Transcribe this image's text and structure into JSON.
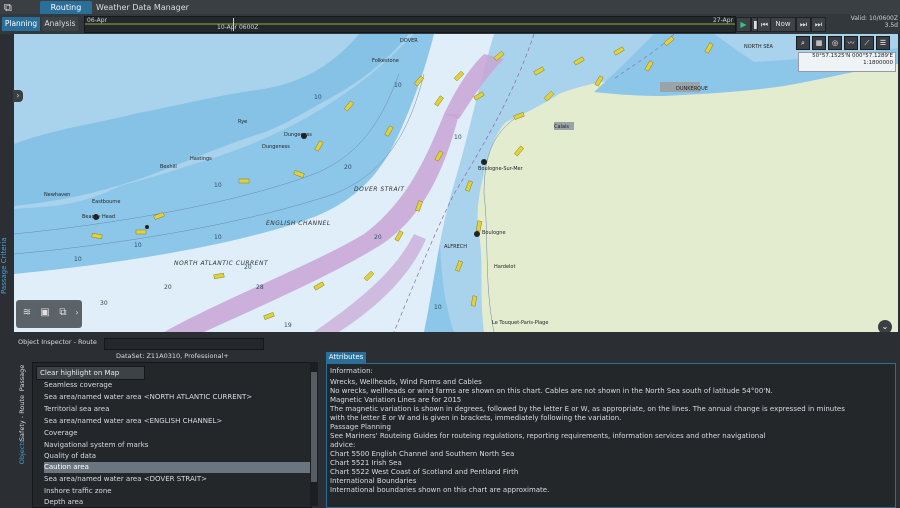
{
  "header": {
    "tabs": [
      {
        "label": "Routing",
        "active": true
      },
      {
        "label": "Weather Data Manager",
        "active": false
      }
    ]
  },
  "toolbar": {
    "mode_tabs": [
      {
        "label": "Planning",
        "active": true
      },
      {
        "label": "Analysis",
        "active": false
      }
    ],
    "timeline": {
      "start_label": "06-Apr",
      "end_label": "27-Apr",
      "cursor_label": "10-Apr",
      "cursor_time": "0600Z"
    },
    "now_label": "Now",
    "valid_label": "Valid: 10/0600Z",
    "valid_sub": "3.5d"
  },
  "map": {
    "coord_lat_lon": "50°57.1525'N 000°57.1289'E",
    "scale": "1:1800000",
    "places": [
      "DOVER",
      "Folkestone",
      "NORTH SEA",
      "DUNKERQUE",
      "Calais",
      "Rye",
      "Dungeness",
      "Dungeness",
      "Hastings",
      "Bexhill",
      "Newhaven",
      "Eastbourne",
      "Beachy Head",
      "Boulogne",
      "Hardelot",
      "Le Touquet-Paris-Plage",
      "Boulogne-Sur-Mer",
      "ALFRECH",
      "DOVER STRAIT"
    ],
    "sea_labels": {
      "english_channel": "ENGLISH CHANNEL",
      "north_atlantic": "NORTH ATLANTIC CURRENT",
      "dover_strait": "DOVER STRAIT"
    },
    "depths": [
      "10",
      "10",
      "20",
      "20",
      "20",
      "28",
      "30",
      "10",
      "10",
      "10",
      "20",
      "10",
      "19",
      "10",
      "10"
    ]
  },
  "left_strip": {
    "label": "Passage Criteria"
  },
  "object_inspector": {
    "title": "Object Inspector - Route",
    "dataset_label": "DataSet: Z11A0310, Professional+",
    "vertical_tabs": [
      {
        "label": "Objects",
        "active": true
      },
      {
        "label": "Safety - Route",
        "active": false
      },
      {
        "label": "Passage",
        "active": false
      }
    ],
    "clear_button": "Clear highlight on Map",
    "items": [
      "Seamless coverage",
      "Sea area/named water area  <NORTH ATLANTIC CURRENT>",
      "Territorial sea area",
      "Sea area/named water area  <ENGLISH CHANNEL>",
      "Coverage",
      "Navigational system of marks",
      "Quality of data",
      "Caution area",
      "Sea area/named water area  <DOVER STRAIT>",
      "Inshore traffic zone",
      "Depth area"
    ],
    "highlighted_index": 7
  },
  "attributes": {
    "tab_label": "Attributes",
    "lines": [
      "Information:",
      "Wrecks, Wellheads, Wind Farms and Cables",
      "No wrecks, wellheads or wind farms are shown on this chart. Cables are not shown in the North Sea south of latitude 54°00'N.",
      "Magnetic Variation Lines are for 2015",
      "The magnetic variation is shown in degrees, followed by the letter E or W, as appropriate, on the lines. The annual change is expressed in minutes",
      "with the letter E or W and is given in brackets, immediately following the variation.",
      "Passage Planning",
      "See Mariners' Routeing Guides for routeing regulations, reporting requirements, information services and other navigational",
      "advice:",
      "Chart 5500 English Channel and Southern North Sea",
      "Chart 5521 Irish Sea",
      "Chart 5522 West Coast of Scotland and Pentland Firth",
      "International Boundaries",
      "International boundaries shown on this chart are approximate."
    ]
  },
  "colors": {
    "accent": "#2a6f99",
    "land": "#e4eccf",
    "shallow": "#8cc7ea",
    "deep": "#e8f1f8",
    "tss": "#c9a5d6",
    "arrow": "#e1d23a"
  },
  "icons": {
    "app_logo": "app-logo-icon",
    "play": "play-icon",
    "map_tools": [
      "zoom-icon",
      "chart-icon",
      "globe-icon",
      "route-icon",
      "ruler-icon",
      "layers-list-icon"
    ]
  }
}
